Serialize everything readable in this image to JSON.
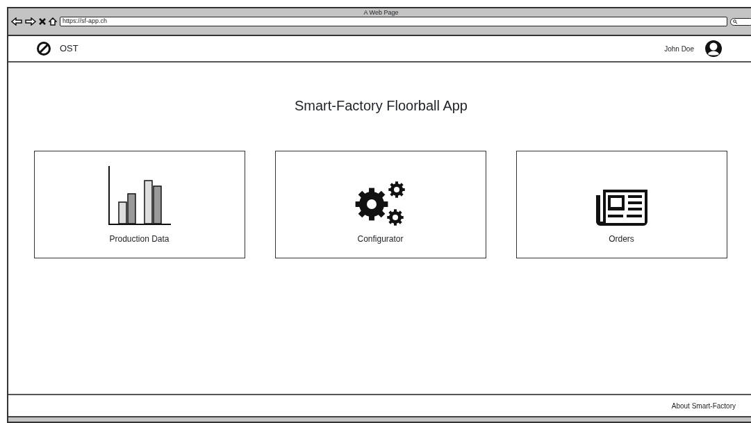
{
  "window": {
    "title": "A Web Page",
    "url": "https://sf-app.ch"
  },
  "navbar": {
    "brand": "OST",
    "user": "John Doe"
  },
  "heading": "Smart-Factory Floorball App",
  "cards": [
    {
      "kind": "chart",
      "label": "Production Data"
    },
    {
      "kind": "gears",
      "label": "Configurator"
    },
    {
      "kind": "newspaper",
      "label": "Orders"
    }
  ],
  "footer": {
    "link": "About Smart-Factory"
  }
}
